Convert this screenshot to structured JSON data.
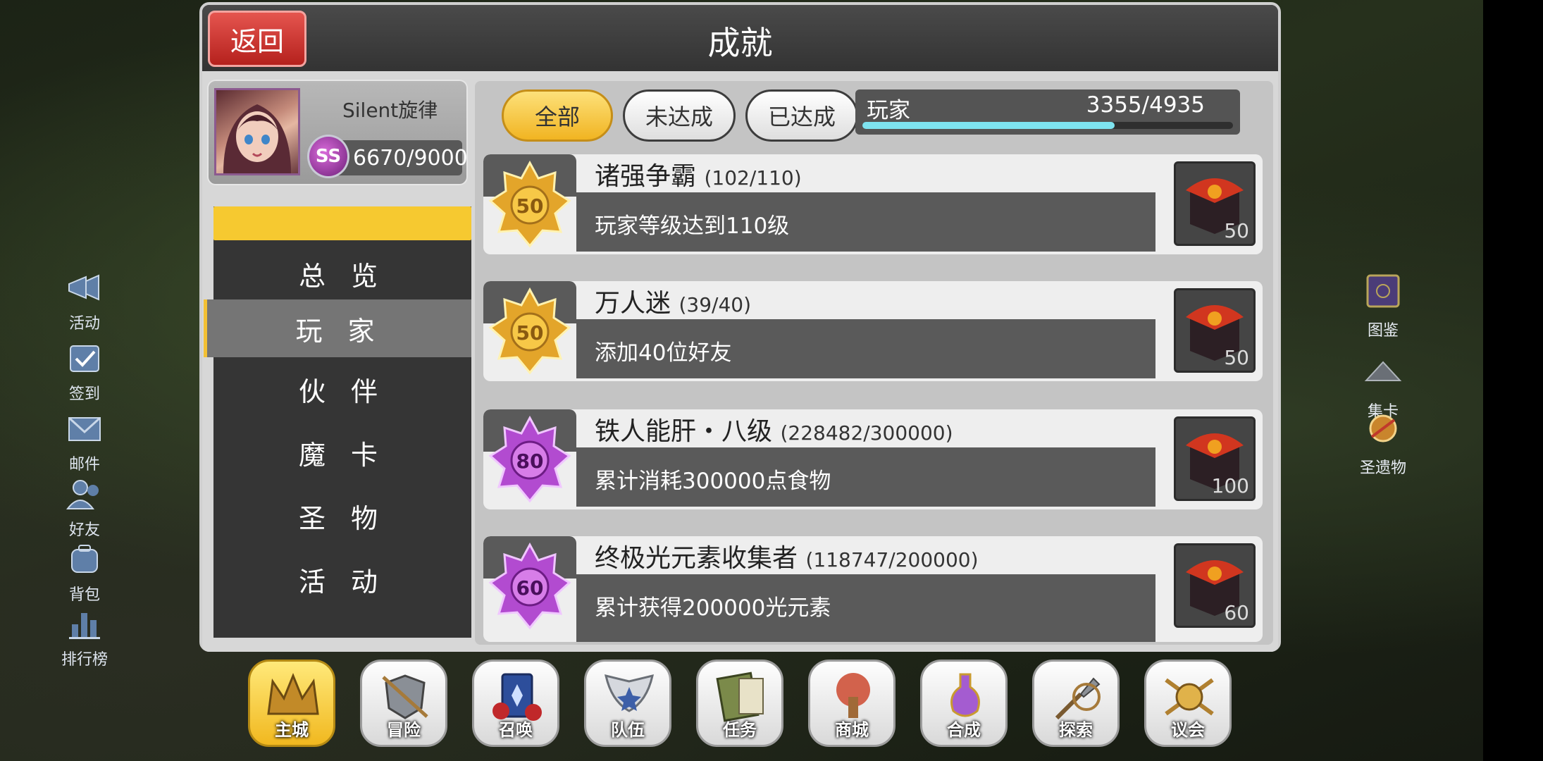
{
  "title": "成就",
  "back_label": "返回",
  "player": {
    "name": "Silent旋律",
    "rank": "SS",
    "exp": "6670/9000"
  },
  "categories": [
    {
      "label": "总 览"
    },
    {
      "label": "玩 家"
    },
    {
      "label": "伙 伴"
    },
    {
      "label": "魔 卡"
    },
    {
      "label": "圣 物"
    },
    {
      "label": "活 动"
    }
  ],
  "filters": [
    "全部",
    "未达成",
    "已达成"
  ],
  "summary": {
    "name": "玩家",
    "count": "3355/4935",
    "progress": 0.68
  },
  "achievements": [
    {
      "title": "诸强争霸",
      "progress": "(102/110)",
      "desc": "玩家等级达到110级",
      "medal": "50",
      "medal_color": "gold",
      "reward": "50"
    },
    {
      "title": "万人迷",
      "progress": "(39/40)",
      "desc": "添加40位好友",
      "medal": "50",
      "medal_color": "gold",
      "reward": "50"
    },
    {
      "title": "铁人能肝・八级",
      "progress": "(228482/300000)",
      "desc": "累计消耗300000点食物",
      "medal": "80",
      "medal_color": "purple",
      "reward": "100"
    },
    {
      "title": "终极光元素收集者",
      "progress": "(118747/200000)",
      "desc": "累计获得200000光元素",
      "medal": "60",
      "medal_color": "purple",
      "reward": "60"
    }
  ],
  "left_menu": [
    "活动",
    "签到",
    "邮件",
    "好友",
    "背包",
    "排行榜"
  ],
  "right_menu": [
    "图鉴",
    "集卡",
    "圣遗物"
  ],
  "bottom_nav": [
    "主城",
    "冒险",
    "召唤",
    "队伍",
    "任务",
    "商城",
    "合成",
    "探索",
    "议会"
  ],
  "colors": {
    "accent_yellow": "#f6c930",
    "back_red": "#d23a35",
    "progress_cyan": "#7ee3ef",
    "purple_medal": "#b24bd0",
    "gold_medal": "#e3a52a"
  }
}
